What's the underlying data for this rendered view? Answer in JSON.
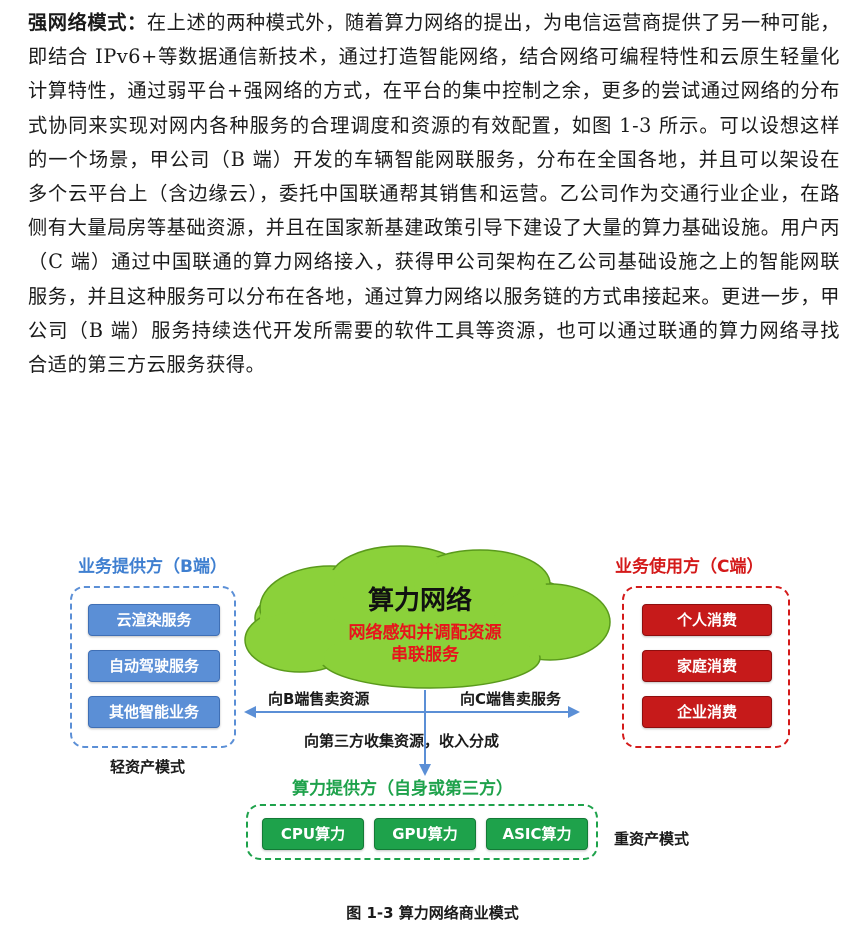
{
  "paragraph": {
    "lead": "强网络模式：",
    "body": "在上述的两种模式外，随着算力网络的提出，为电信运营商提供了另一种可能，即结合 IPv6+等数据通信新技术，通过打造智能网络，结合网络可编程特性和云原生轻量化计算特性，通过弱平台+强网络的方式，在平台的集中控制之余，更多的尝试通过网络的分布式协同来实现对网内各种服务的合理调度和资源的有效配置，如图 1-3 所示。可以设想这样的一个场景，甲公司（B 端）开发的车辆智能网联服务，分布在全国各地，并且可以架设在多个云平台上（含边缘云），委托中国联通帮其销售和运营。乙公司作为交通行业企业，在路侧有大量局房等基础资源，并且在国家新基建政策引导下建设了大量的算力基础设施。用户丙（C 端）通过中国联通的算力网络接入，获得甲公司架构在乙公司基础设施之上的智能网联服务，并且这种服务可以分布在各地，通过算力网络以服务链的方式串接起来。更进一步，甲公司（B 端）服务持续迭代开发所需要的软件工具等资源，也可以通过联通的算力网络寻找合适的第三方云服务获得。"
  },
  "diagram": {
    "provider": {
      "title": "业务提供方（B端）",
      "items": [
        "云渲染服务",
        "自动驾驶服务",
        "其他智能业务"
      ],
      "mode": "轻资产模式"
    },
    "consumer": {
      "title": "业务使用方（C端）",
      "items": [
        "个人消费",
        "家庭消费",
        "企业消费"
      ]
    },
    "cloud": {
      "title": "算力网络",
      "line1": "网络感知并调配资源",
      "line2": "串联服务"
    },
    "arrows": {
      "left": "向B端售卖资源",
      "right": "向C端售卖服务",
      "down": "向第三方收集资源，收入分成"
    },
    "supplier": {
      "title": "算力提供方（自身或第三方）",
      "items": [
        "CPU算力",
        "GPU算力",
        "ASIC算力"
      ],
      "mode": "重资产模式"
    }
  },
  "caption": "图 1-3  算力网络商业模式",
  "colors": {
    "blue": "#5b8fd6",
    "red": "#c61a1a",
    "green": "#1ea24b",
    "cloud": "#8bd13a"
  }
}
